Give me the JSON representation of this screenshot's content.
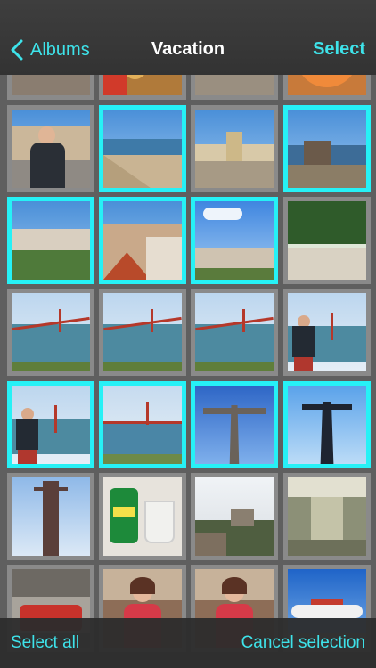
{
  "nav": {
    "back_label": "Albums",
    "title": "Vacation",
    "select_label": "Select"
  },
  "toolbar": {
    "select_all": "Select all",
    "cancel_selection": "Cancel selection"
  },
  "colors": {
    "accent": "#3ee3ea",
    "selection_border": "#26f1f6"
  },
  "photos": [
    {
      "scene": "street-partial",
      "selected": false
    },
    {
      "scene": "food-partial",
      "selected": false
    },
    {
      "scene": "plaza-partial",
      "selected": false
    },
    {
      "scene": "food-partial-2",
      "selected": false
    },
    {
      "scene": "man-portrait-city",
      "selected": false
    },
    {
      "scene": "riverside-promenade",
      "selected": true
    },
    {
      "scene": "plaza-arch",
      "selected": false
    },
    {
      "scene": "river-shore",
      "selected": true
    },
    {
      "scene": "city-overlook",
      "selected": true
    },
    {
      "scene": "rooftops",
      "selected": true
    },
    {
      "scene": "city-view-sky",
      "selected": true
    },
    {
      "scene": "tree-park",
      "selected": false
    },
    {
      "scene": "bridge-view",
      "selected": false
    },
    {
      "scene": "bridge-view",
      "selected": false
    },
    {
      "scene": "bridge-view",
      "selected": false
    },
    {
      "scene": "man-bridge",
      "selected": false
    },
    {
      "scene": "man-bridge",
      "selected": true
    },
    {
      "scene": "bridge-river",
      "selected": true
    },
    {
      "scene": "statue-sky",
      "selected": true
    },
    {
      "scene": "statue-silhouette",
      "selected": true
    },
    {
      "scene": "tall-statue",
      "selected": false
    },
    {
      "scene": "soda-can",
      "selected": false
    },
    {
      "scene": "castle-hill",
      "selected": false
    },
    {
      "scene": "train-interior",
      "selected": false
    },
    {
      "scene": "train-station",
      "selected": false
    },
    {
      "scene": "woman-restaurant",
      "selected": false
    },
    {
      "scene": "woman-restaurant",
      "selected": false
    },
    {
      "scene": "airplane",
      "selected": false
    }
  ]
}
